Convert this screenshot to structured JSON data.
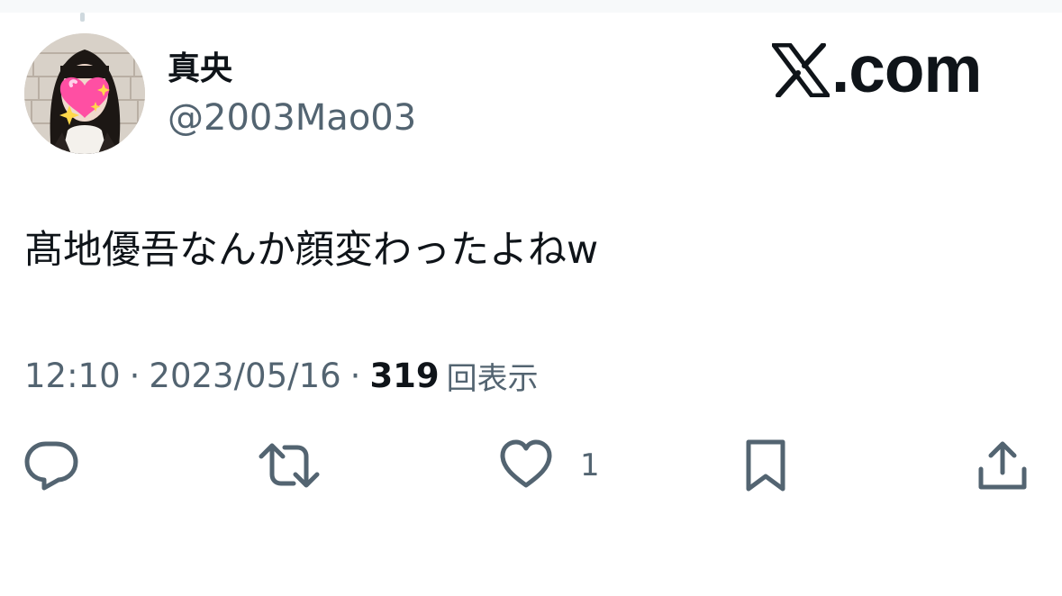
{
  "tweet": {
    "author": {
      "display_name": "真央",
      "handle": "@2003Mao03"
    },
    "brand": {
      "logo_icon": "x-logo-icon",
      "domain": ".com"
    },
    "text": "髙地優吾なんか顔変わったよねw",
    "meta": {
      "time": "12:10",
      "separator": "·",
      "date": "2023/05/16",
      "views": "319",
      "views_label": "回表示"
    },
    "actions": {
      "reply_icon": "reply-icon",
      "retweet_icon": "retweet-icon",
      "like_icon": "heart-icon",
      "like_count": "1",
      "bookmark_icon": "bookmark-icon",
      "share_icon": "share-icon"
    }
  },
  "colors": {
    "text_primary": "#0f1419",
    "text_secondary": "#536471",
    "icon": "#536471",
    "background": "#ffffff",
    "avatar_heart": "#ff4fa3"
  }
}
